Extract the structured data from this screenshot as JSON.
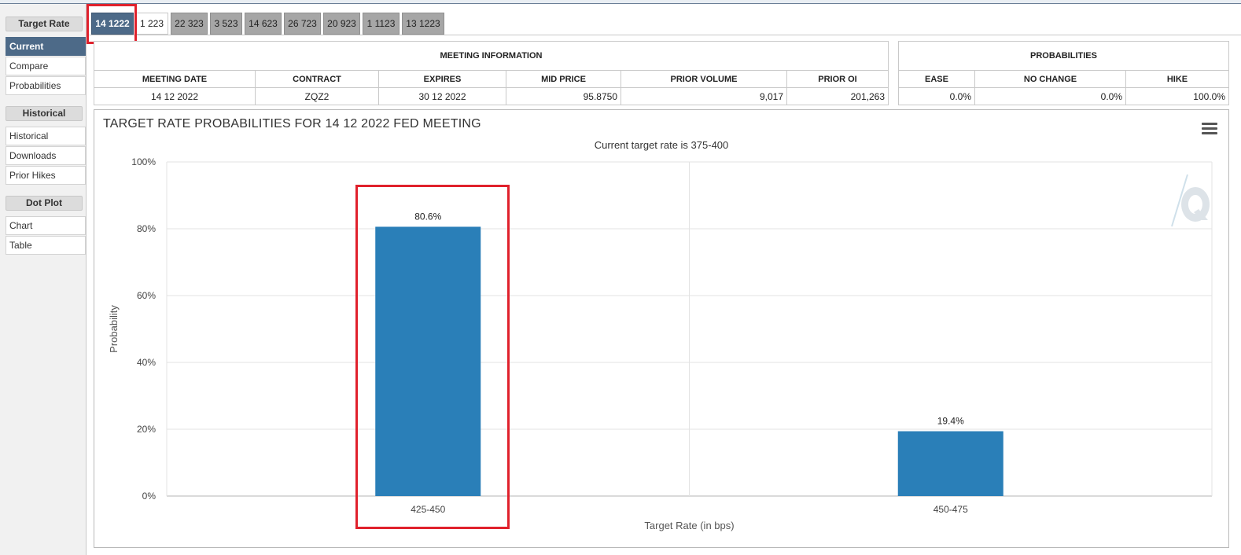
{
  "sidebar": {
    "sections": [
      {
        "heading": "Target Rate",
        "items": [
          "Current",
          "Compare",
          "Probabilities"
        ]
      },
      {
        "heading": "Historical",
        "items": [
          "Historical",
          "Downloads",
          "Prior Hikes"
        ]
      },
      {
        "heading": "Dot Plot",
        "items": [
          "Chart",
          "Table"
        ]
      }
    ],
    "active_item": "Current"
  },
  "tabs": [
    "14 1222",
    "1 223",
    "22 323",
    "3 523",
    "14 623",
    "26 723",
    "20 923",
    "1 1123",
    "13 1223"
  ],
  "meeting_info": {
    "title": "MEETING INFORMATION",
    "headers": [
      "MEETING DATE",
      "CONTRACT",
      "EXPIRES",
      "MID PRICE",
      "PRIOR VOLUME",
      "PRIOR OI"
    ],
    "row": [
      "14 12 2022",
      "ZQZ2",
      "30 12 2022",
      "95.8750",
      "9,017",
      "201,263"
    ]
  },
  "probabilities": {
    "title": "PROBABILITIES",
    "headers": [
      "EASE",
      "NO CHANGE",
      "HIKE"
    ],
    "row": [
      "0.0%",
      "0.0%",
      "100.0%"
    ]
  },
  "chart_data": {
    "type": "bar",
    "title": "TARGET RATE PROBABILITIES FOR 14 12 2022 FED MEETING",
    "subtitle": "Current target rate is 375-400",
    "xlabel": "Target Rate (in bps)",
    "ylabel": "Probability",
    "categories": [
      "425-450",
      "450-475"
    ],
    "values": [
      80.6,
      19.4
    ],
    "data_labels": [
      "80.6%",
      "19.4%"
    ],
    "y_ticks": [
      "0%",
      "20%",
      "40%",
      "60%",
      "80%",
      "100%"
    ],
    "ylim": [
      0,
      100
    ],
    "grid": true,
    "bar_color": "#2a7fb8"
  },
  "colors": {
    "accent": "#4d6a88",
    "highlight": "#e0212c"
  }
}
